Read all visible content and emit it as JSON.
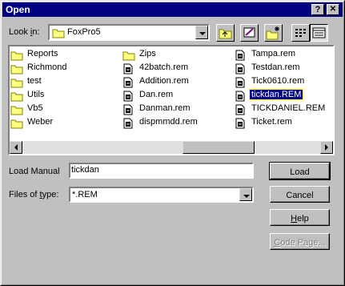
{
  "window": {
    "title": "Open",
    "help_glyph": "?",
    "close_glyph": "✕"
  },
  "lookin": {
    "label_pre": "Look ",
    "label_key": "i",
    "label_post": "n:",
    "folder": "FoxPro5"
  },
  "files": {
    "col1": [
      {
        "name": "Reports",
        "type": "folder"
      },
      {
        "name": "Richmond",
        "type": "folder"
      },
      {
        "name": "test",
        "type": "folder"
      },
      {
        "name": "Utils",
        "type": "folder"
      },
      {
        "name": "Vb5",
        "type": "folder"
      },
      {
        "name": "Weber",
        "type": "folder"
      }
    ],
    "col2": [
      {
        "name": "Zips",
        "type": "folder"
      },
      {
        "name": "42batch.rem",
        "type": "file"
      },
      {
        "name": "Addition.rem",
        "type": "file"
      },
      {
        "name": "Dan.rem",
        "type": "file"
      },
      {
        "name": "Danman.rem",
        "type": "file"
      },
      {
        "name": "dispmmdd.rem",
        "type": "file"
      }
    ],
    "col3": [
      {
        "name": "Tampa.rem",
        "type": "file"
      },
      {
        "name": "Testdan.rem",
        "type": "file"
      },
      {
        "name": "Tick0610.rem",
        "type": "file"
      },
      {
        "name": "tickdan.REM",
        "type": "file",
        "selected": true
      },
      {
        "name": "TICKDANIEL.REM",
        "type": "file"
      },
      {
        "name": "Ticket.rem",
        "type": "file"
      }
    ]
  },
  "filename": {
    "label": "Load Manual",
    "value": "tickdan"
  },
  "filetype": {
    "label_pre": "Files of ",
    "label_key": "t",
    "label_post": "ype:",
    "value": "*.REM"
  },
  "buttons": {
    "load": "Load",
    "cancel": "Cancel",
    "help_key": "H",
    "help_rest": "elp",
    "codepage_key": "C",
    "codepage_rest": "ode Page..."
  },
  "colors": {
    "titlebar": "#000080",
    "face": "#c0c0c0",
    "selection": "#000080"
  }
}
